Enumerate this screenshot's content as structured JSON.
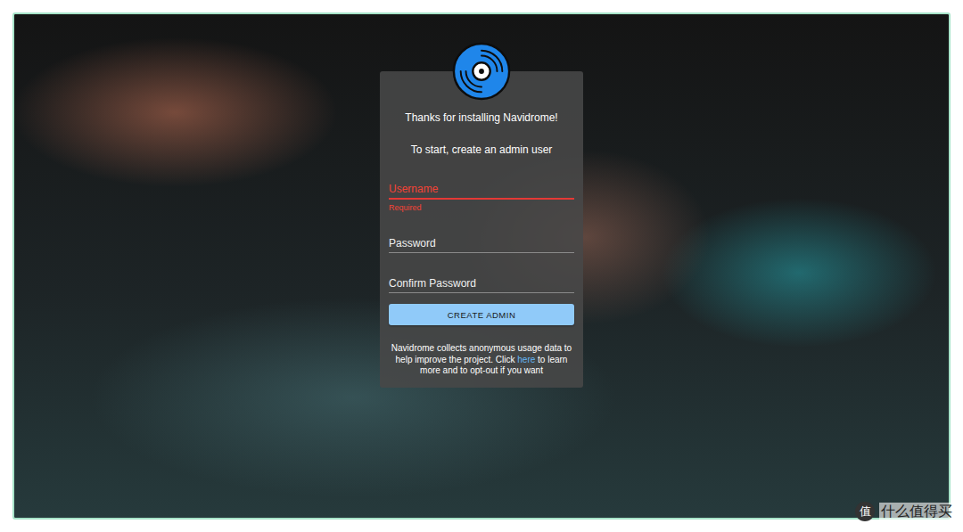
{
  "welcome": {
    "title": "Thanks for installing Navidrome!",
    "subtitle": "To start, create an admin user"
  },
  "fields": [
    {
      "label": "Username",
      "error": true,
      "helper": "Required"
    },
    {
      "label": "Password",
      "error": false
    },
    {
      "label": "Confirm Password",
      "error": false
    }
  ],
  "submit": {
    "label": "CREATE ADMIN"
  },
  "notice": {
    "before": "Navidrome collects anonymous usage data to help improve the project. Click ",
    "link": "here",
    "after": " to learn more and to opt-out if you want"
  },
  "watermark": {
    "badge": "值",
    "text": "什么值得买"
  }
}
